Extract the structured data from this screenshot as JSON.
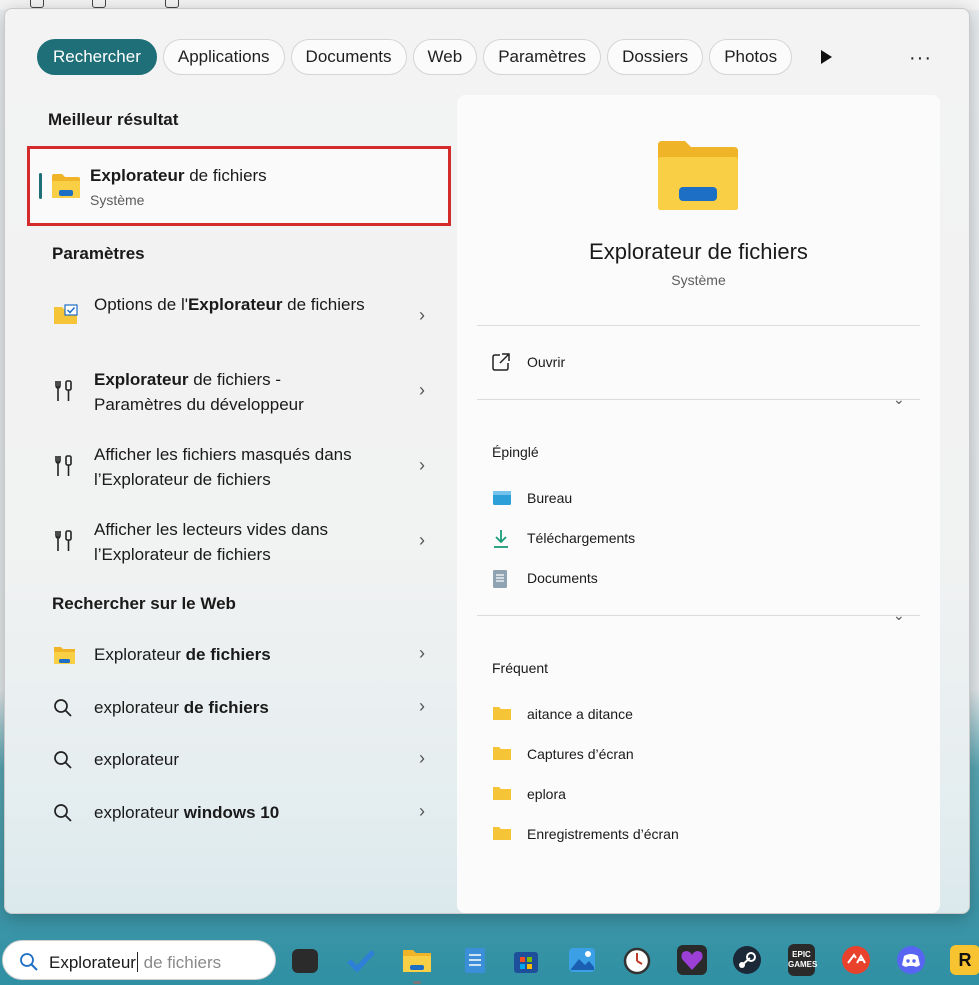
{
  "filter_tabs": [
    "Rechercher",
    "Applications",
    "Documents",
    "Web",
    "Paramètres",
    "Dossiers",
    "Photos"
  ],
  "more_icon": "play-arrow-icon",
  "ellipsis": "···",
  "best_match": {
    "heading": "Meilleur résultat",
    "title_bold": "Explorateur",
    "title_rest": " de fichiers",
    "subtitle": "Système",
    "icon": "folder-icon"
  },
  "settings": {
    "heading": "Paramètres",
    "items": [
      {
        "pre": "Options de l'",
        "bold": "Explorateur",
        "post": " de fichiers",
        "icon": "folder-options-icon"
      },
      {
        "pre": "",
        "bold": "Explorateur",
        "post": " de fichiers - Paramètres du développeur",
        "icon": "dev-tools-icon"
      },
      {
        "pre": "Afficher les fichiers masqués dans l’Explorateur de fichiers",
        "bold": "",
        "post": "",
        "icon": "dev-tools-icon"
      },
      {
        "pre": "Afficher les lecteurs vides dans l’Explorateur de fichiers",
        "bold": "",
        "post": "",
        "icon": "dev-tools-icon"
      }
    ]
  },
  "web": {
    "heading": "Rechercher sur le Web",
    "items": [
      {
        "pre": "Explorateur ",
        "bold": "de fichiers",
        "icon": "folder-icon"
      },
      {
        "pre": "explorateur ",
        "bold": "de fichiers",
        "icon": "search-icon"
      },
      {
        "pre": "explorateur",
        "bold": "",
        "icon": "search-icon"
      },
      {
        "pre": "explorateur ",
        "bold": "windows 10",
        "icon": "search-icon"
      }
    ]
  },
  "detail": {
    "title": "Explorateur de fichiers",
    "subtitle": "Système",
    "open_label": "Ouvrir",
    "pinned_heading": "Épinglé",
    "pinned": [
      "Bureau",
      "Téléchargements",
      "Documents"
    ],
    "frequent_heading": "Fréquent",
    "frequent": [
      "aitance a ditance",
      "Captures d’écran",
      "eplora",
      "Enregistrements d’écran"
    ]
  },
  "taskbar": {
    "search_typed": "Explorateur",
    "search_suggest": " de fichiers",
    "apps": [
      "task-view-icon",
      "todo-icon",
      "file-explorer-icon",
      "notepad-icon",
      "store-icon",
      "photos-icon",
      "clock-icon",
      "heart-app-icon",
      "steam-icon",
      "epic-games-icon",
      "ea-icon",
      "discord-icon",
      "rockstar-icon"
    ]
  },
  "colors": {
    "accent": "#1f6f78",
    "highlight_border": "#d32a2a",
    "folder": "#f6c437"
  }
}
